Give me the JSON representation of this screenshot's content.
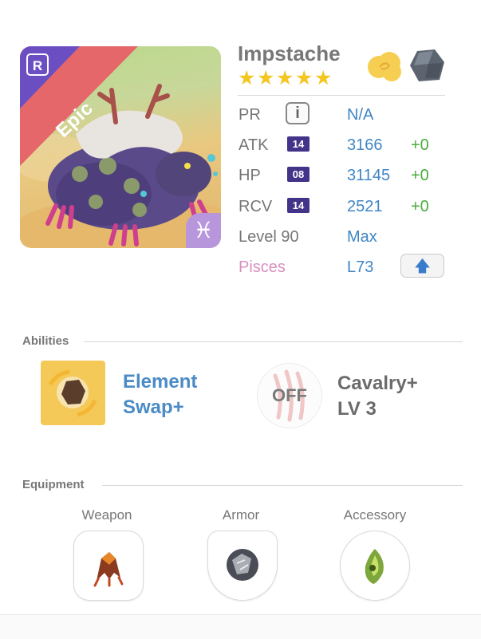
{
  "hero": {
    "name": "Impstache",
    "rarity": "Epic",
    "rank_badge": "R",
    "zodiac_glyph": "♓",
    "stars": 5,
    "elements": [
      "light-cloud-icon",
      "earth-rock-icon"
    ]
  },
  "stats": {
    "pr": {
      "label": "PR",
      "value": "N/A"
    },
    "atk": {
      "label": "ATK",
      "level": "14",
      "value": "3166",
      "bonus": "+0"
    },
    "hp": {
      "label": "HP",
      "level": "08",
      "value": "31145",
      "bonus": "+0"
    },
    "rcv": {
      "label": "RCV",
      "level": "14",
      "value": "2521",
      "bonus": "+0"
    },
    "level": {
      "label": "Level 90",
      "value": "Max"
    },
    "zodiac": {
      "label": "Pisces",
      "value": "L73",
      "color": "#d98fc0"
    }
  },
  "abilities": {
    "title": "Abilities",
    "items": [
      {
        "name_line1": "Element",
        "name_line2": "Swap+",
        "icon": "element-swap-icon"
      },
      {
        "name_line1": "Cavalry+",
        "name_line2": "LV 3",
        "state": "OFF",
        "icon": "cavalry-claw-icon"
      }
    ]
  },
  "equipment": {
    "title": "Equipment",
    "slots": [
      {
        "label": "Weapon",
        "icon": "claw-weapon-icon"
      },
      {
        "label": "Armor",
        "icon": "stone-armor-icon"
      },
      {
        "label": "Accessory",
        "icon": "green-gem-icon"
      }
    ]
  },
  "colors": {
    "value_blue": "#3f86c5",
    "bonus_green": "#4aac3c",
    "level_badge": "#443489",
    "star_gold": "#f5c521",
    "epic_band": "#e5676a",
    "rank_corner": "#6b4fc2"
  }
}
